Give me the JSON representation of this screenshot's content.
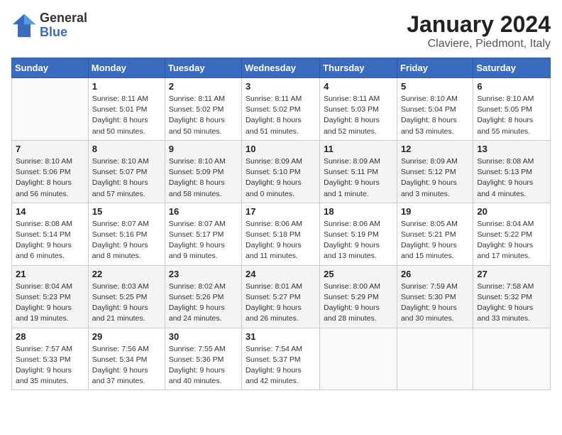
{
  "logo": {
    "line1": "General",
    "line2": "Blue"
  },
  "title": "January 2024",
  "subtitle": "Claviere, Piedmont, Italy",
  "days_of_week": [
    "Sunday",
    "Monday",
    "Tuesday",
    "Wednesday",
    "Thursday",
    "Friday",
    "Saturday"
  ],
  "weeks": [
    [
      {
        "num": "",
        "empty": true
      },
      {
        "num": "1",
        "sunrise": "8:11 AM",
        "sunset": "5:01 PM",
        "daylight": "8 hours and 50 minutes."
      },
      {
        "num": "2",
        "sunrise": "8:11 AM",
        "sunset": "5:02 PM",
        "daylight": "8 hours and 50 minutes."
      },
      {
        "num": "3",
        "sunrise": "8:11 AM",
        "sunset": "5:02 PM",
        "daylight": "8 hours and 51 minutes."
      },
      {
        "num": "4",
        "sunrise": "8:11 AM",
        "sunset": "5:03 PM",
        "daylight": "8 hours and 52 minutes."
      },
      {
        "num": "5",
        "sunrise": "8:10 AM",
        "sunset": "5:04 PM",
        "daylight": "8 hours and 53 minutes."
      },
      {
        "num": "6",
        "sunrise": "8:10 AM",
        "sunset": "5:05 PM",
        "daylight": "8 hours and 55 minutes."
      }
    ],
    [
      {
        "num": "7",
        "sunrise": "8:10 AM",
        "sunset": "5:06 PM",
        "daylight": "8 hours and 56 minutes."
      },
      {
        "num": "8",
        "sunrise": "8:10 AM",
        "sunset": "5:07 PM",
        "daylight": "8 hours and 57 minutes."
      },
      {
        "num": "9",
        "sunrise": "8:10 AM",
        "sunset": "5:09 PM",
        "daylight": "8 hours and 58 minutes."
      },
      {
        "num": "10",
        "sunrise": "8:09 AM",
        "sunset": "5:10 PM",
        "daylight": "9 hours and 0 minutes."
      },
      {
        "num": "11",
        "sunrise": "8:09 AM",
        "sunset": "5:11 PM",
        "daylight": "9 hours and 1 minute."
      },
      {
        "num": "12",
        "sunrise": "8:09 AM",
        "sunset": "5:12 PM",
        "daylight": "9 hours and 3 minutes."
      },
      {
        "num": "13",
        "sunrise": "8:08 AM",
        "sunset": "5:13 PM",
        "daylight": "9 hours and 4 minutes."
      }
    ],
    [
      {
        "num": "14",
        "sunrise": "8:08 AM",
        "sunset": "5:14 PM",
        "daylight": "9 hours and 6 minutes."
      },
      {
        "num": "15",
        "sunrise": "8:07 AM",
        "sunset": "5:16 PM",
        "daylight": "9 hours and 8 minutes."
      },
      {
        "num": "16",
        "sunrise": "8:07 AM",
        "sunset": "5:17 PM",
        "daylight": "9 hours and 9 minutes."
      },
      {
        "num": "17",
        "sunrise": "8:06 AM",
        "sunset": "5:18 PM",
        "daylight": "9 hours and 11 minutes."
      },
      {
        "num": "18",
        "sunrise": "8:06 AM",
        "sunset": "5:19 PM",
        "daylight": "9 hours and 13 minutes."
      },
      {
        "num": "19",
        "sunrise": "8:05 AM",
        "sunset": "5:21 PM",
        "daylight": "9 hours and 15 minutes."
      },
      {
        "num": "20",
        "sunrise": "8:04 AM",
        "sunset": "5:22 PM",
        "daylight": "9 hours and 17 minutes."
      }
    ],
    [
      {
        "num": "21",
        "sunrise": "8:04 AM",
        "sunset": "5:23 PM",
        "daylight": "9 hours and 19 minutes."
      },
      {
        "num": "22",
        "sunrise": "8:03 AM",
        "sunset": "5:25 PM",
        "daylight": "9 hours and 21 minutes."
      },
      {
        "num": "23",
        "sunrise": "8:02 AM",
        "sunset": "5:26 PM",
        "daylight": "9 hours and 24 minutes."
      },
      {
        "num": "24",
        "sunrise": "8:01 AM",
        "sunset": "5:27 PM",
        "daylight": "9 hours and 26 minutes."
      },
      {
        "num": "25",
        "sunrise": "8:00 AM",
        "sunset": "5:29 PM",
        "daylight": "9 hours and 28 minutes."
      },
      {
        "num": "26",
        "sunrise": "7:59 AM",
        "sunset": "5:30 PM",
        "daylight": "9 hours and 30 minutes."
      },
      {
        "num": "27",
        "sunrise": "7:58 AM",
        "sunset": "5:32 PM",
        "daylight": "9 hours and 33 minutes."
      }
    ],
    [
      {
        "num": "28",
        "sunrise": "7:57 AM",
        "sunset": "5:33 PM",
        "daylight": "9 hours and 35 minutes."
      },
      {
        "num": "29",
        "sunrise": "7:56 AM",
        "sunset": "5:34 PM",
        "daylight": "9 hours and 37 minutes."
      },
      {
        "num": "30",
        "sunrise": "7:55 AM",
        "sunset": "5:36 PM",
        "daylight": "9 hours and 40 minutes."
      },
      {
        "num": "31",
        "sunrise": "7:54 AM",
        "sunset": "5:37 PM",
        "daylight": "9 hours and 42 minutes."
      },
      {
        "num": "",
        "empty": true
      },
      {
        "num": "",
        "empty": true
      },
      {
        "num": "",
        "empty": true
      }
    ]
  ],
  "labels": {
    "sunrise_prefix": "Sunrise: ",
    "sunset_prefix": "Sunset: ",
    "daylight_prefix": "Daylight: "
  }
}
